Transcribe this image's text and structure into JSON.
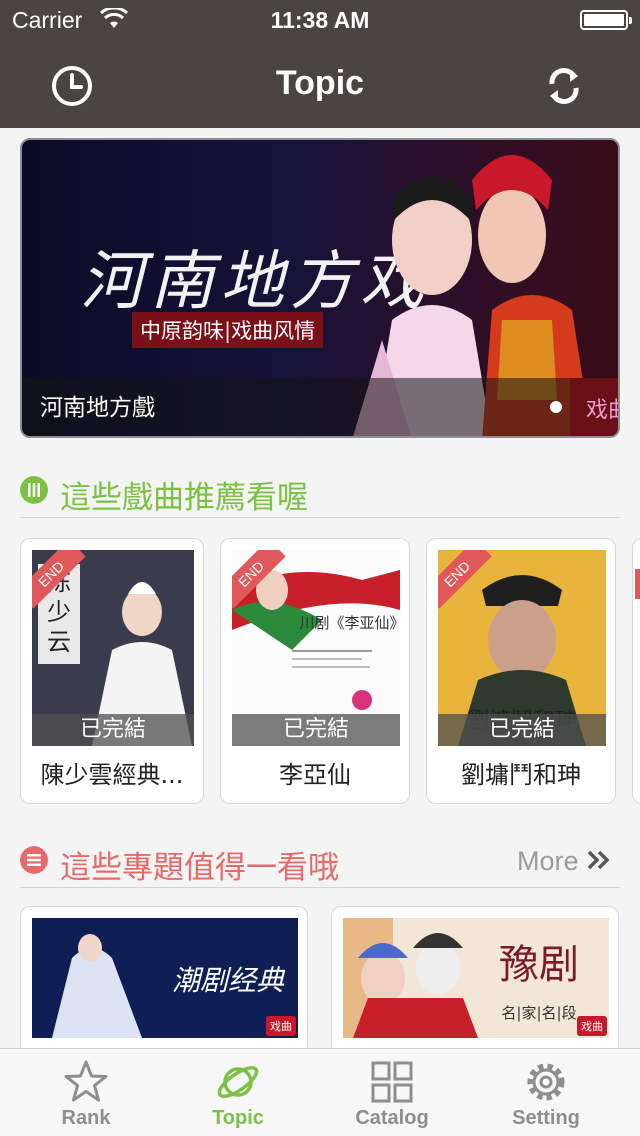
{
  "status_bar": {
    "carrier": "Carrier",
    "time": "11:38 AM"
  },
  "nav": {
    "title": "Topic",
    "left_icon": "history-clock-icon",
    "right_icon": "refresh-icon"
  },
  "banner": {
    "art_title": "河南地方戏",
    "art_subtitle": "中原韵味|戏曲风情",
    "caption": "河南地方戲",
    "next_peek": "戏曲",
    "page_dots": 1,
    "active_dot": 0
  },
  "recommend": {
    "title": "這些戲曲推薦看喔",
    "accent": "#7cc144",
    "items": [
      {
        "title": "陳少雲經典...",
        "ribbon": "END",
        "status": "已完結",
        "poster_text": "陈少云"
      },
      {
        "title": "李亞仙",
        "ribbon": "END",
        "status": "已完結",
        "poster_text": "川剧《李亚仙》"
      },
      {
        "title": "劉墉鬥和珅",
        "ribbon": "END",
        "status": "已完結",
        "poster_text": "劉墉鬥和珅"
      }
    ]
  },
  "topics": {
    "title": "這些專題值得一看哦",
    "accent": "#e66a6a",
    "more_label": "More",
    "items": [
      {
        "poster_text": "潮剧经典",
        "tag": "戏曲"
      },
      {
        "poster_text": "豫剧",
        "poster_sub": "名|家|名|段",
        "tag": "戏曲"
      }
    ]
  },
  "tabbar": {
    "active_color": "#7cc144",
    "items": [
      {
        "label": "Rank",
        "icon": "star-icon",
        "active": false
      },
      {
        "label": "Topic",
        "icon": "planet-icon",
        "active": true
      },
      {
        "label": "Catalog",
        "icon": "grid-icon",
        "active": false
      },
      {
        "label": "Setting",
        "icon": "gear-icon",
        "active": false
      }
    ]
  }
}
